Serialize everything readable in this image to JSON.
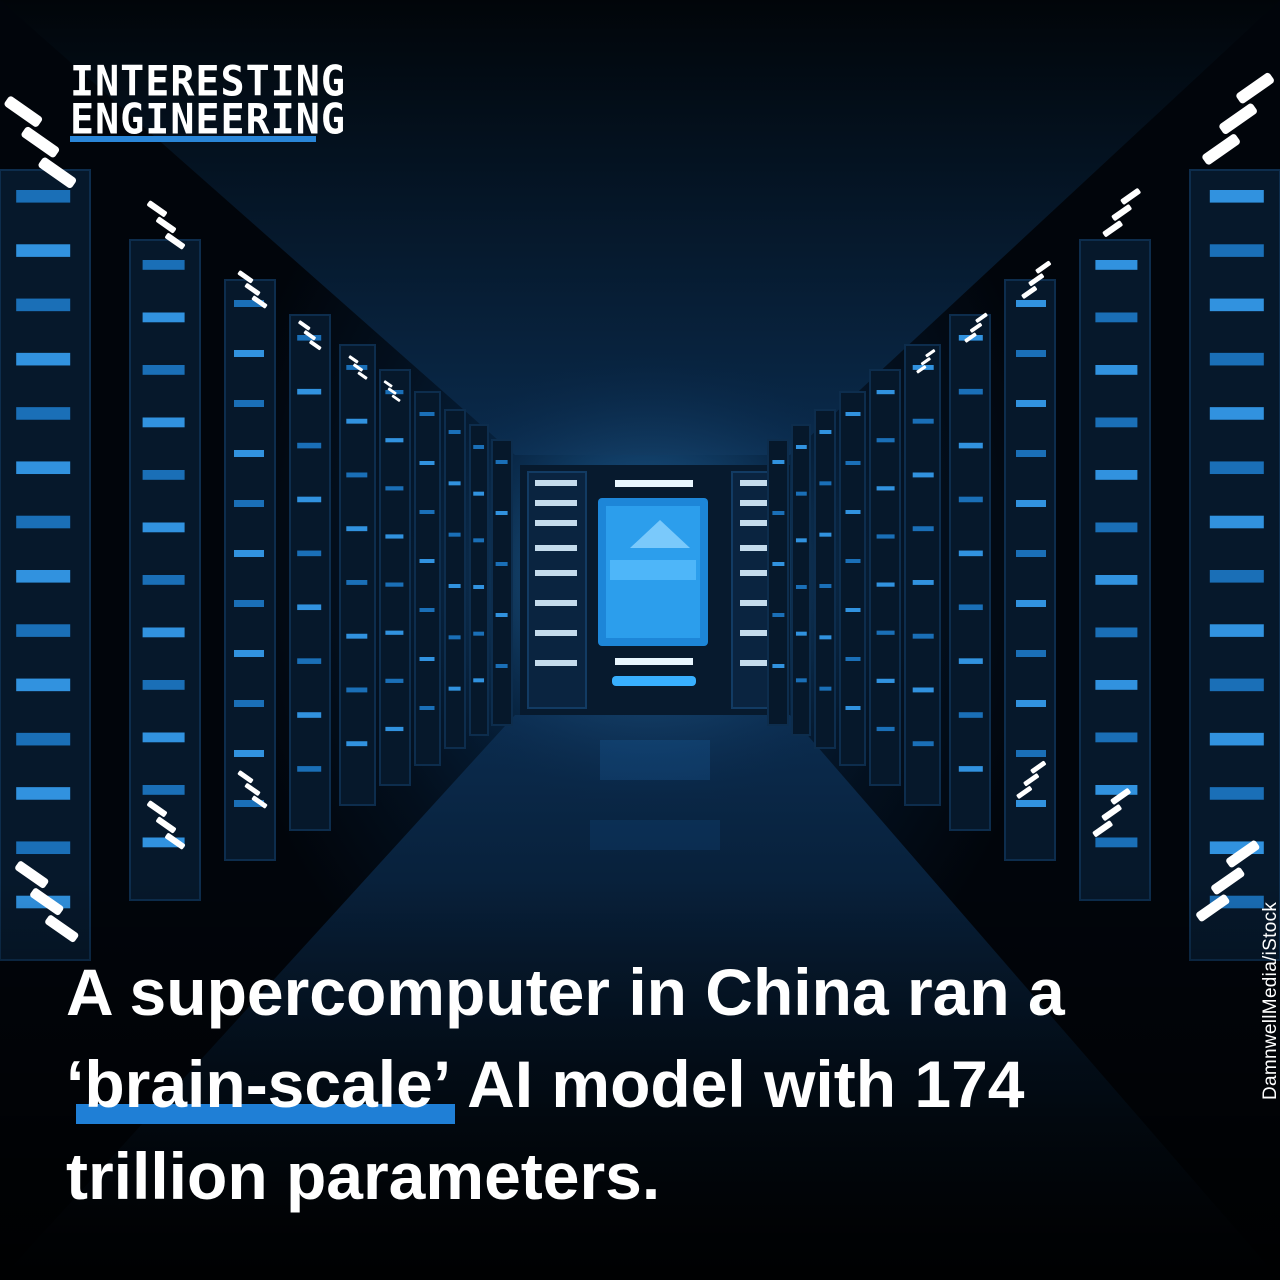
{
  "logo": {
    "line1": "INTERESTING",
    "line2": "ENGINEERING"
  },
  "credit": "DamnwellMedia/iStock",
  "headline": {
    "part1": "A supercomputer in China ran a",
    "highlight": "‘brain-scale’",
    "part2": "AI model with 174",
    "part3": "trillion parameters."
  },
  "colors": {
    "accent": "#1f7fd6",
    "text": "#ffffff",
    "background": "#02060d",
    "glow": "#3aa8ff"
  }
}
